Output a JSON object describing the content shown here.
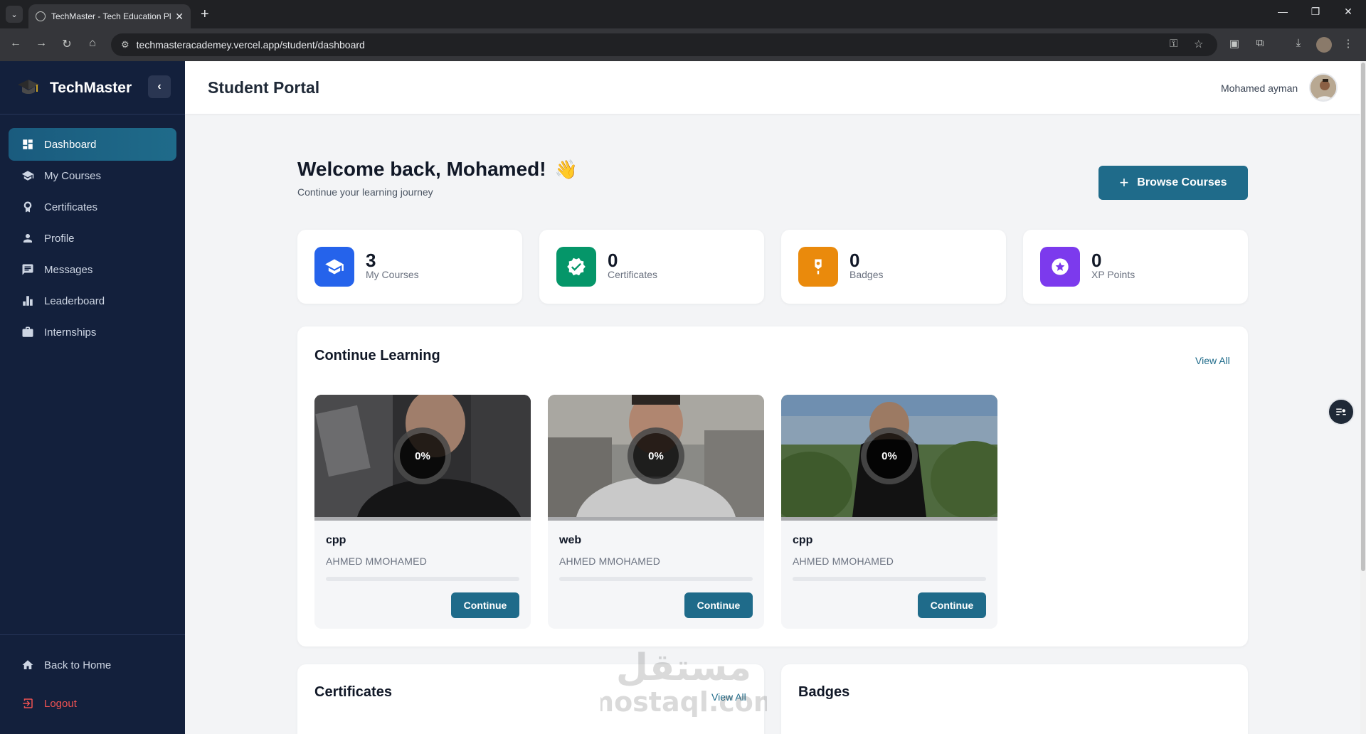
{
  "browser": {
    "tab_title": "TechMaster - Tech Education Pl",
    "url": "techmasteracademey.vercel.app/student/dashboard"
  },
  "sidebar": {
    "brand": "TechMaster",
    "items": [
      {
        "label": "Dashboard",
        "icon": "dashboard-icon",
        "active": true
      },
      {
        "label": "My Courses",
        "icon": "graduation-cap-icon"
      },
      {
        "label": "Certificates",
        "icon": "award-icon"
      },
      {
        "label": "Profile",
        "icon": "user-icon"
      },
      {
        "label": "Messages",
        "icon": "message-icon"
      },
      {
        "label": "Leaderboard",
        "icon": "bar-chart-icon"
      },
      {
        "label": "Internships",
        "icon": "briefcase-icon"
      }
    ],
    "footer": {
      "back_home": "Back to Home",
      "logout": "Logout"
    }
  },
  "header": {
    "title": "Student Portal",
    "user_name": "Mohamed ayman"
  },
  "main": {
    "welcome": "Welcome back, Mohamed!",
    "wave": "👋",
    "subtitle": "Continue your learning journey",
    "browse_button": "Browse Courses",
    "stats": [
      {
        "value": "3",
        "label": "My Courses",
        "color": "#2563eb",
        "icon": "graduation-cap-icon"
      },
      {
        "value": "0",
        "label": "Certificates",
        "color": "#059669",
        "icon": "verified-badge-icon"
      },
      {
        "value": "0",
        "label": "Badges",
        "color": "#ea8a0c",
        "icon": "medal-icon"
      },
      {
        "value": "0",
        "label": "XP Points",
        "color": "#7c3aed",
        "icon": "star-icon"
      }
    ],
    "continue_learning": {
      "title": "Continue Learning",
      "view_all": "View All",
      "courses": [
        {
          "name": "cpp",
          "instructor": "AHMED MMOHAMED",
          "progress_label": "0%",
          "progress": 0,
          "button": "Continue"
        },
        {
          "name": "web",
          "instructor": "AHMED MMOHAMED",
          "progress_label": "0%",
          "progress": 0,
          "button": "Continue"
        },
        {
          "name": "cpp",
          "instructor": "AHMED MMOHAMED",
          "progress_label": "0%",
          "progress": 0,
          "button": "Continue"
        }
      ]
    },
    "certificates": {
      "title": "Certificates",
      "view_all": "View All"
    },
    "badges": {
      "title": "Badges"
    }
  },
  "watermark": {
    "arabic": "مستقل",
    "latin": "mostaql.com"
  },
  "colors": {
    "accent": "#1f6b8a",
    "sidebar_bg": "#13203c",
    "logout": "#f05252"
  }
}
